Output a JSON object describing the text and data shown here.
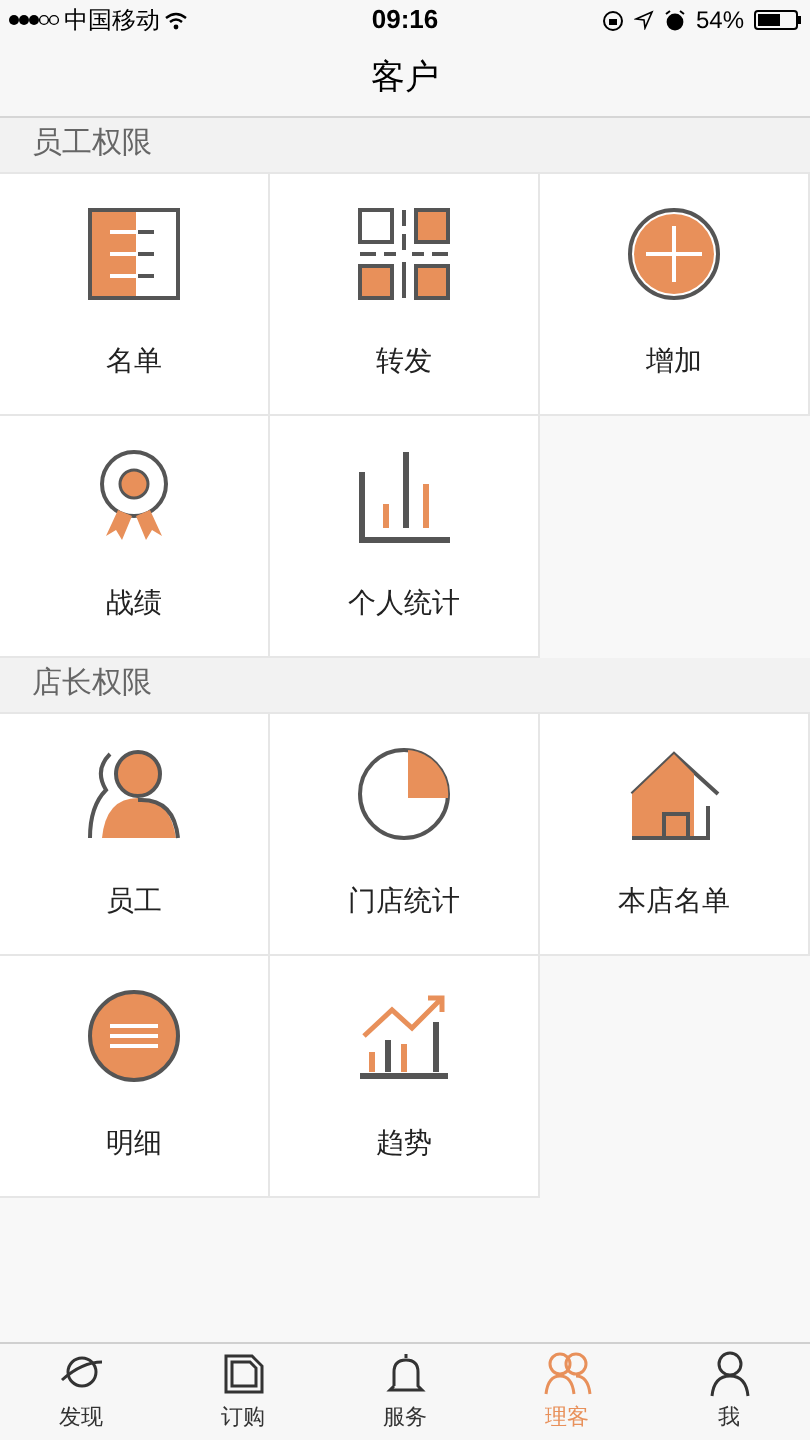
{
  "status_bar": {
    "carrier": "中国移动",
    "time": "09:16",
    "battery": "54%"
  },
  "nav": {
    "title": "客户"
  },
  "sections": [
    {
      "title": "员工权限",
      "items": [
        {
          "label": "名单",
          "kind": "list"
        },
        {
          "label": "转发",
          "kind": "forward"
        },
        {
          "label": "增加",
          "kind": "add"
        },
        {
          "label": "战绩",
          "kind": "medal"
        },
        {
          "label": "个人统计",
          "kind": "bars"
        }
      ]
    },
    {
      "title": "店长权限",
      "items": [
        {
          "label": "员工",
          "kind": "staff"
        },
        {
          "label": "门店统计",
          "kind": "pie"
        },
        {
          "label": "本店名单",
          "kind": "house"
        },
        {
          "label": "明细",
          "kind": "detail"
        },
        {
          "label": "趋势",
          "kind": "trend"
        }
      ]
    }
  ],
  "tab_bar": [
    {
      "label": "发现",
      "kind": "planet",
      "selected": false
    },
    {
      "label": "订购",
      "kind": "card",
      "selected": false
    },
    {
      "label": "服务",
      "kind": "bell",
      "selected": false
    },
    {
      "label": "理客",
      "kind": "people",
      "selected": true
    },
    {
      "label": "我",
      "kind": "person",
      "selected": false
    }
  ]
}
